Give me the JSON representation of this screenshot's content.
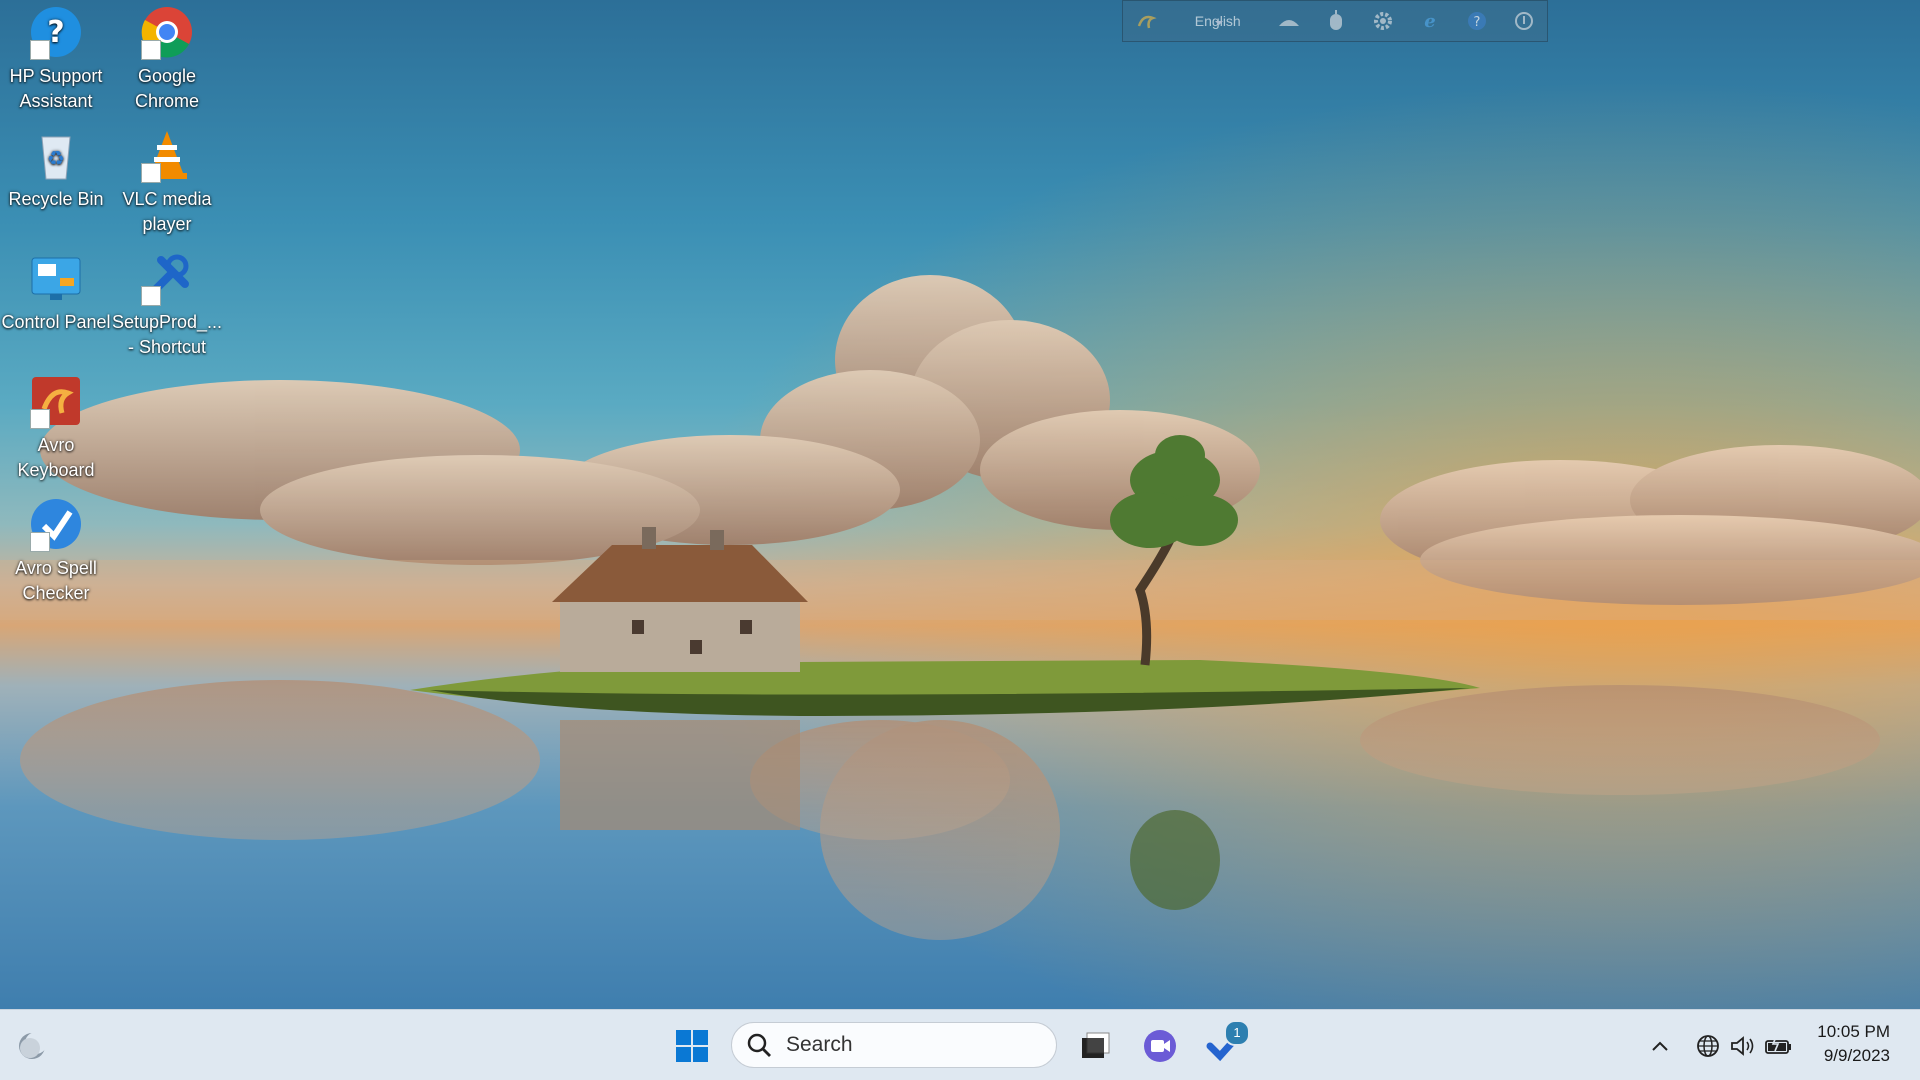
{
  "desktop": {
    "icons": [
      {
        "label": "HP Support Assistant"
      },
      {
        "label": "Google Chrome"
      },
      {
        "label": "Recycle Bin"
      },
      {
        "label": "VLC media player"
      },
      {
        "label": "Control Panel"
      },
      {
        "label": "SetupProd_... - Shortcut"
      },
      {
        "label": "Avro Keyboard"
      },
      {
        "label": "Avro Spell Checker"
      }
    ]
  },
  "language_bar": {
    "language": "English",
    "icons": [
      "avro-logo-icon",
      "keyboard-layout-icon",
      "mouse-icon",
      "settings-gear-icon",
      "web-icon",
      "help-icon",
      "about-icon"
    ]
  },
  "taskbar": {
    "search_placeholder": "Search",
    "task_badge": "1",
    "clock_time": "10:05 PM",
    "clock_date": "9/9/2023",
    "colors": {
      "accent": "#0a78d4",
      "background": "#dfe8f1"
    }
  }
}
